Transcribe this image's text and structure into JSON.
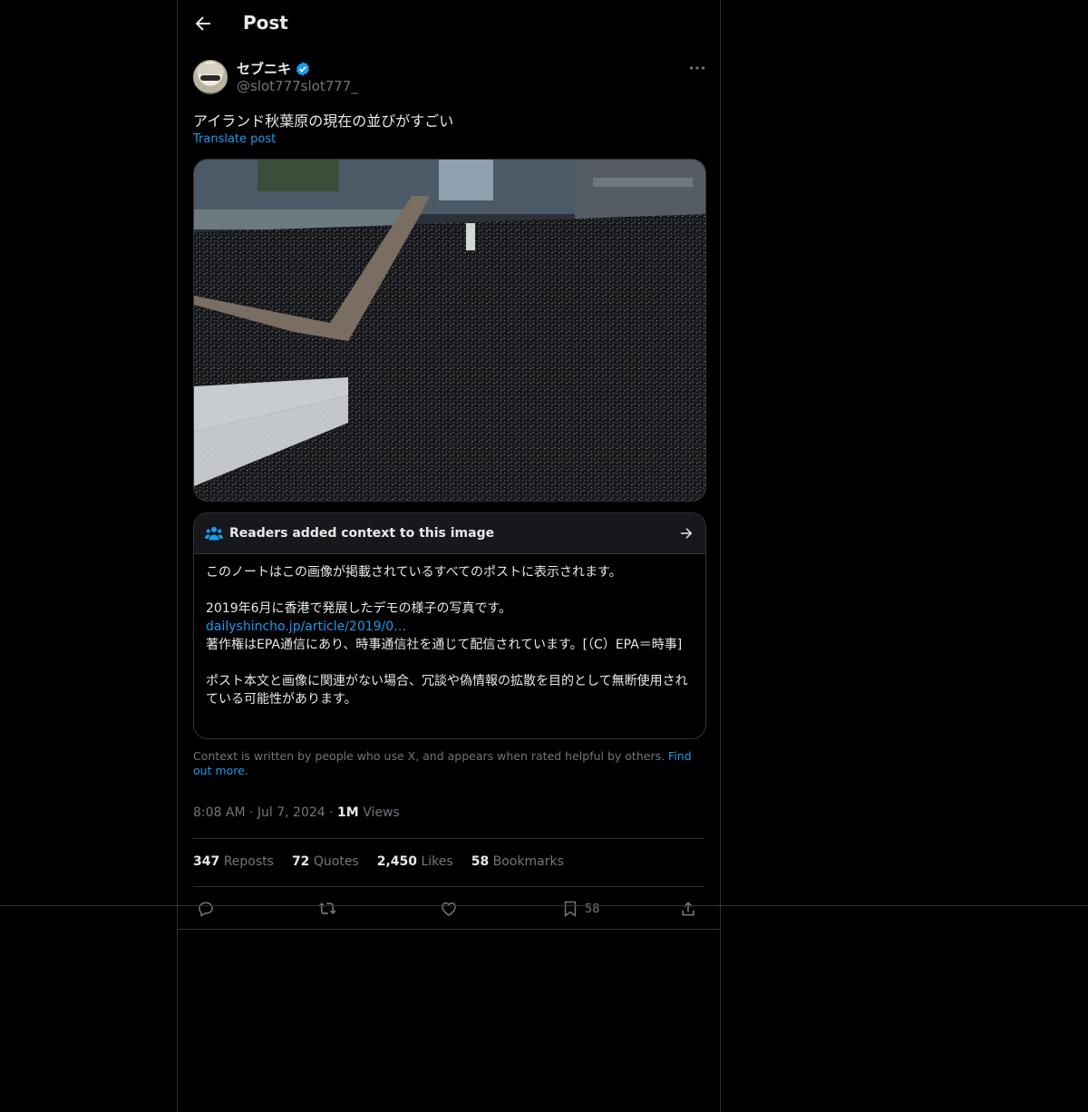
{
  "header": {
    "title": "Post"
  },
  "author": {
    "display_name": "セブニキ",
    "handle": "@slot777slot777_",
    "verified": true
  },
  "post": {
    "text": "アイランド秋葉原の現在の並びがすごい",
    "translate_label": "Translate post"
  },
  "note": {
    "title": "Readers added context to this image",
    "line1": "このノートはこの画像が掲載されているすべてのポストに表示されます。",
    "line2": "2019年6月に香港で発展したデモの様子の写真です。",
    "link": "dailyshincho.jp/article/2019/0…",
    "line3": "著作権はEPA通信にあり、時事通信社を通じて配信されています。[（C）EPA＝時事]",
    "line4": "ポスト本文と画像に関連がない場合、冗談や偽情報の拡散を目的として無断使用されている可能性があります。"
  },
  "context": {
    "text": "Context is written by people who use X, and appears when rated helpful by others.",
    "find_out": "Find out more."
  },
  "meta": {
    "time": "8:08 AM",
    "date": "Jul 7, 2024",
    "views_count": "1M",
    "views_label": "Views"
  },
  "stats": {
    "reposts_count": "347",
    "reposts_label": "Reposts",
    "quotes_count": "72",
    "quotes_label": "Quotes",
    "likes_count": "2,450",
    "likes_label": "Likes",
    "bookmarks_count": "58",
    "bookmarks_label": "Bookmarks"
  },
  "actions": {
    "bookmark_count": "58"
  },
  "colors": {
    "background": "#000000",
    "accent": "#1d9bf0",
    "muted": "#71767b",
    "border": "#2f3336"
  }
}
